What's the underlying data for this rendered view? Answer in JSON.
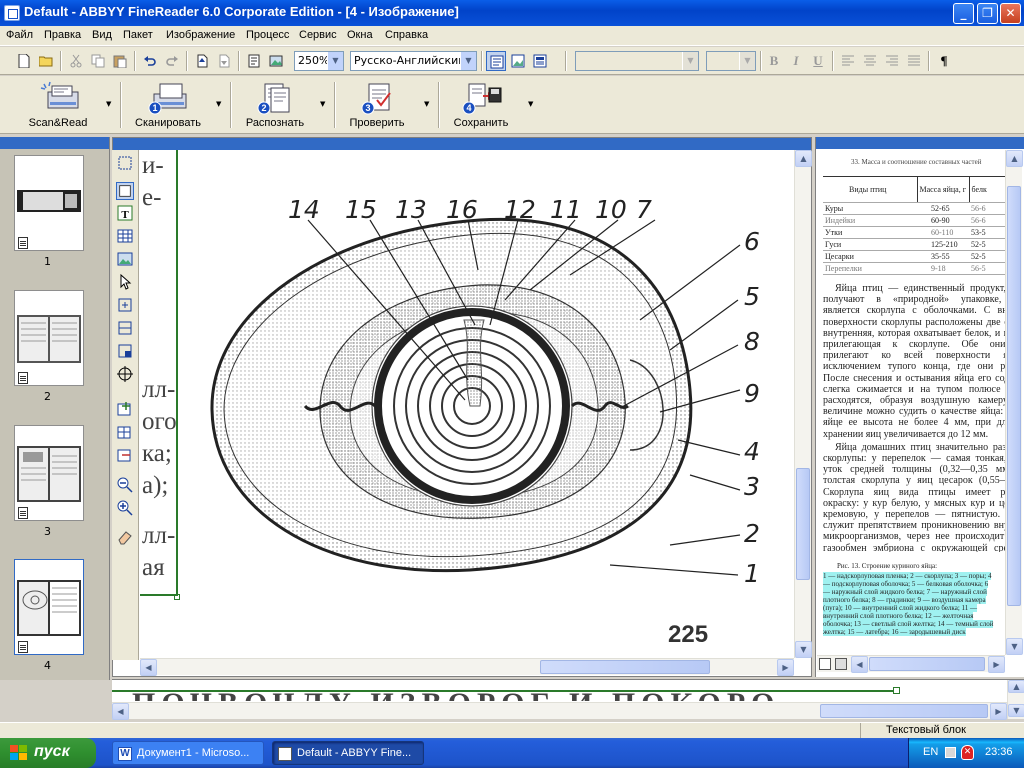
{
  "window": {
    "title": "Default - ABBYY FineReader 6.0 Corporate Edition - [4 - Изображение]",
    "minimize": "_",
    "maximize": "❐",
    "close": "✕"
  },
  "menu": [
    "Файл",
    "Правка",
    "Вид",
    "Пакет",
    "Изображение",
    "Процесс",
    "Сервис",
    "Окна",
    "Справка"
  ],
  "toolbar": {
    "zoom": "250%",
    "language": "Русско-Английский",
    "font_name": "",
    "font_size": "",
    "format_buttons": [
      "B",
      "I",
      "U"
    ],
    "paragraph_mark": "¶"
  },
  "steps": [
    {
      "label": "Scan&Read",
      "number": ""
    },
    {
      "label": "Сканировать",
      "number": "1"
    },
    {
      "label": "Распознать",
      "number": "2"
    },
    {
      "label": "Проверить",
      "number": "3"
    },
    {
      "label": "Сохранить",
      "number": "4"
    }
  ],
  "pages": [
    {
      "number": "1"
    },
    {
      "number": "2"
    },
    {
      "number": "3"
    },
    {
      "number": "4"
    }
  ],
  "image": {
    "callouts_top": [
      "14",
      "15",
      "13",
      "16",
      "12",
      "11",
      "10",
      "7"
    ],
    "callouts_right": [
      "6",
      "5",
      "8",
      "9",
      "4",
      "3",
      "2",
      "1"
    ],
    "page_number": "225",
    "left_margin_text": [
      "и-",
      "е-",
      "лл-",
      "ого",
      "ка;",
      "а);",
      "лл-",
      "ая"
    ]
  },
  "text": {
    "table_caption": "33. Масса и соотношение составных частей",
    "table_headers": [
      "Виды птиц",
      "Масса яйца, г",
      "белк"
    ],
    "table_rows": [
      [
        "Куры",
        "52-65",
        "56-6"
      ],
      [
        "Индейки",
        "60-90",
        "56-6"
      ],
      [
        "Утки",
        "60-110",
        "53-5"
      ],
      [
        "Гуси",
        "125-210",
        "52-5"
      ],
      [
        "Цесарки",
        "35-55",
        "52-5"
      ],
      [
        "Перепелки",
        "9-18",
        "56-5"
      ]
    ],
    "paragraph1": "Яйца птиц — единственный продукт, который получают в «природной» упаковке, которой является скорлупа с оболочками. С внутренней поверхности скорлупы расположены две оболочки: внутренняя, которая охватывает белок, и наружная, прилегающая к скорлупе. Обе они плотно прилегают ко всей поверхности яйца, за исключением тупого конца, где они разделены. После снесения и остывания яйца его содержимое слегка сжимается и на тупом полюсе оболочки расходятся, образуя воздушную камеру. По ее величине можно судить о качестве яйца: в свежем яйце ее высота не более 4 мм, при длительном хранении яиц увеличивается до 12 мм.",
    "paragraph2": "Яйца домашних птиц значительно различаются скорлупы: у перепелок — самая тонкая, у кур и уток средней толщины (0,32—0,35 мм); самая толстая скорлупа у яиц цесарок (0,55—0,6 мм). Скорлупа яиц вида птицы имеет различную окраску: у кур белую, у мясных кур и цесарок — кремовую, у перепелов — пятнистую. Скорлупа служит препятствием проникновению внутрь яйца микроорганизмов, через нее происходит влаго- и газообмен эмбриона с окружающей средой, для чего в скорлупе имеются поры.",
    "figure_caption": "Рис. 13. Строение куриного яйца:",
    "figure_legend": "1 — надскорлуповая пленка; 2 — скорлупа; 3 — поры; 4 — подскорлуповая оболочка; 5 — белковая оболочка; 6 — наружный слой жидкого белка; 7 — наружный слой плотного белка; 8 — градинки; 9 — воздушная камера (пуга); 10 — внутренний слой жидкого белка; 11 — внутренний слой плотного белка; 12 — желточная оболочка; 13 — светлый слой желтка; 14 — темный слой желтка; 15 — латебра; 16 — зародышевый диск"
  },
  "zoom_strip_text": "ПОЧВОЧЛУ ИЗВОРОГ И ПОКОРО",
  "status": {
    "mode": "Текстовый блок"
  },
  "taskbar": {
    "start": "пуск",
    "tasks": [
      "Документ1 - Microso...",
      "Default - ABBYY Fine..."
    ],
    "language": "EN",
    "clock": "23:36"
  }
}
